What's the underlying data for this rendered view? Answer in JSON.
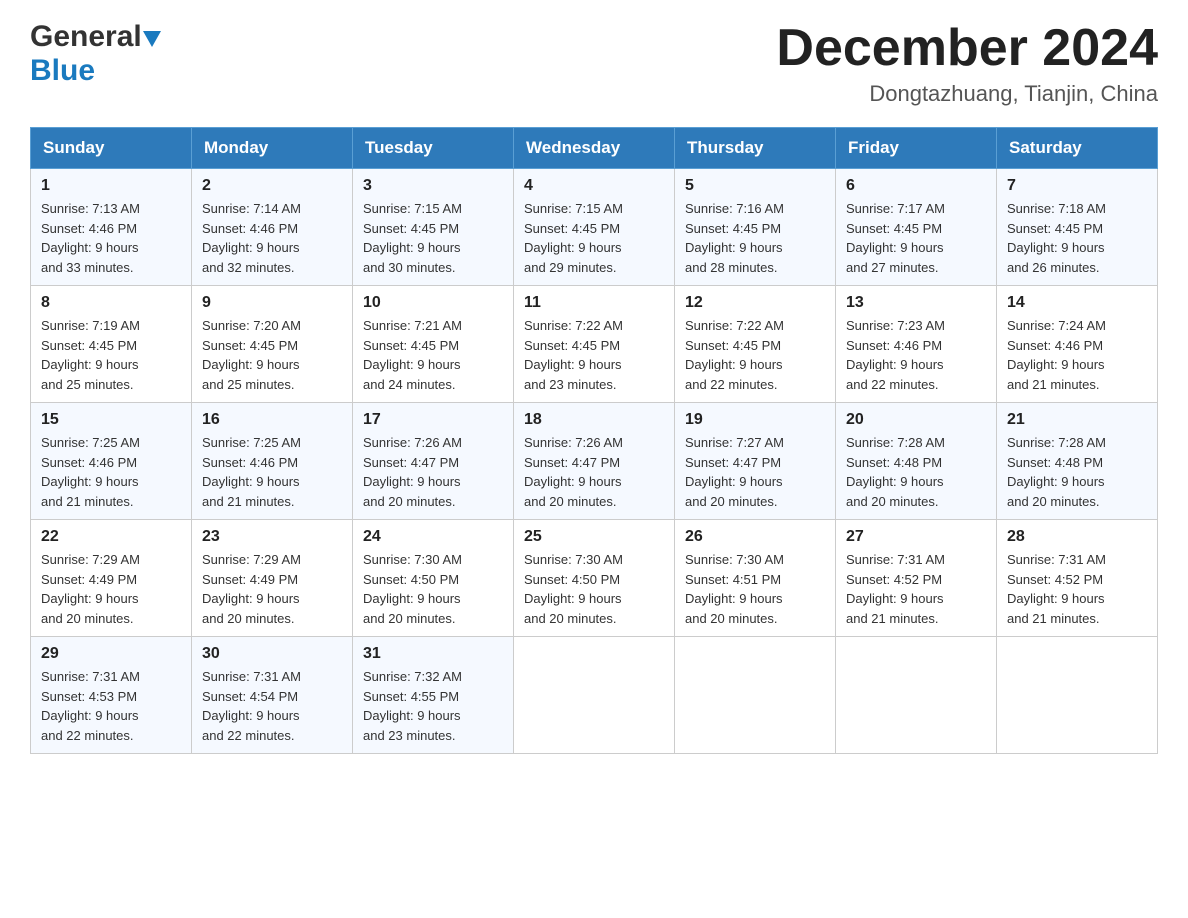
{
  "header": {
    "logo_general": "General",
    "logo_blue": "Blue",
    "main_title": "December 2024",
    "subtitle": "Dongtazhuang, Tianjin, China"
  },
  "days_of_week": [
    "Sunday",
    "Monday",
    "Tuesday",
    "Wednesday",
    "Thursday",
    "Friday",
    "Saturday"
  ],
  "weeks": [
    [
      {
        "day": "1",
        "sunrise": "7:13 AM",
        "sunset": "4:46 PM",
        "daylight": "9 hours and 33 minutes."
      },
      {
        "day": "2",
        "sunrise": "7:14 AM",
        "sunset": "4:46 PM",
        "daylight": "9 hours and 32 minutes."
      },
      {
        "day": "3",
        "sunrise": "7:15 AM",
        "sunset": "4:45 PM",
        "daylight": "9 hours and 30 minutes."
      },
      {
        "day": "4",
        "sunrise": "7:15 AM",
        "sunset": "4:45 PM",
        "daylight": "9 hours and 29 minutes."
      },
      {
        "day": "5",
        "sunrise": "7:16 AM",
        "sunset": "4:45 PM",
        "daylight": "9 hours and 28 minutes."
      },
      {
        "day": "6",
        "sunrise": "7:17 AM",
        "sunset": "4:45 PM",
        "daylight": "9 hours and 27 minutes."
      },
      {
        "day": "7",
        "sunrise": "7:18 AM",
        "sunset": "4:45 PM",
        "daylight": "9 hours and 26 minutes."
      }
    ],
    [
      {
        "day": "8",
        "sunrise": "7:19 AM",
        "sunset": "4:45 PM",
        "daylight": "9 hours and 25 minutes."
      },
      {
        "day": "9",
        "sunrise": "7:20 AM",
        "sunset": "4:45 PM",
        "daylight": "9 hours and 25 minutes."
      },
      {
        "day": "10",
        "sunrise": "7:21 AM",
        "sunset": "4:45 PM",
        "daylight": "9 hours and 24 minutes."
      },
      {
        "day": "11",
        "sunrise": "7:22 AM",
        "sunset": "4:45 PM",
        "daylight": "9 hours and 23 minutes."
      },
      {
        "day": "12",
        "sunrise": "7:22 AM",
        "sunset": "4:45 PM",
        "daylight": "9 hours and 22 minutes."
      },
      {
        "day": "13",
        "sunrise": "7:23 AM",
        "sunset": "4:46 PM",
        "daylight": "9 hours and 22 minutes."
      },
      {
        "day": "14",
        "sunrise": "7:24 AM",
        "sunset": "4:46 PM",
        "daylight": "9 hours and 21 minutes."
      }
    ],
    [
      {
        "day": "15",
        "sunrise": "7:25 AM",
        "sunset": "4:46 PM",
        "daylight": "9 hours and 21 minutes."
      },
      {
        "day": "16",
        "sunrise": "7:25 AM",
        "sunset": "4:46 PM",
        "daylight": "9 hours and 21 minutes."
      },
      {
        "day": "17",
        "sunrise": "7:26 AM",
        "sunset": "4:47 PM",
        "daylight": "9 hours and 20 minutes."
      },
      {
        "day": "18",
        "sunrise": "7:26 AM",
        "sunset": "4:47 PM",
        "daylight": "9 hours and 20 minutes."
      },
      {
        "day": "19",
        "sunrise": "7:27 AM",
        "sunset": "4:47 PM",
        "daylight": "9 hours and 20 minutes."
      },
      {
        "day": "20",
        "sunrise": "7:28 AM",
        "sunset": "4:48 PM",
        "daylight": "9 hours and 20 minutes."
      },
      {
        "day": "21",
        "sunrise": "7:28 AM",
        "sunset": "4:48 PM",
        "daylight": "9 hours and 20 minutes."
      }
    ],
    [
      {
        "day": "22",
        "sunrise": "7:29 AM",
        "sunset": "4:49 PM",
        "daylight": "9 hours and 20 minutes."
      },
      {
        "day": "23",
        "sunrise": "7:29 AM",
        "sunset": "4:49 PM",
        "daylight": "9 hours and 20 minutes."
      },
      {
        "day": "24",
        "sunrise": "7:30 AM",
        "sunset": "4:50 PM",
        "daylight": "9 hours and 20 minutes."
      },
      {
        "day": "25",
        "sunrise": "7:30 AM",
        "sunset": "4:50 PM",
        "daylight": "9 hours and 20 minutes."
      },
      {
        "day": "26",
        "sunrise": "7:30 AM",
        "sunset": "4:51 PM",
        "daylight": "9 hours and 20 minutes."
      },
      {
        "day": "27",
        "sunrise": "7:31 AM",
        "sunset": "4:52 PM",
        "daylight": "9 hours and 21 minutes."
      },
      {
        "day": "28",
        "sunrise": "7:31 AM",
        "sunset": "4:52 PM",
        "daylight": "9 hours and 21 minutes."
      }
    ],
    [
      {
        "day": "29",
        "sunrise": "7:31 AM",
        "sunset": "4:53 PM",
        "daylight": "9 hours and 22 minutes."
      },
      {
        "day": "30",
        "sunrise": "7:31 AM",
        "sunset": "4:54 PM",
        "daylight": "9 hours and 22 minutes."
      },
      {
        "day": "31",
        "sunrise": "7:32 AM",
        "sunset": "4:55 PM",
        "daylight": "9 hours and 23 minutes."
      },
      null,
      null,
      null,
      null
    ]
  ],
  "labels": {
    "sunrise": "Sunrise:",
    "sunset": "Sunset:",
    "daylight": "Daylight:"
  }
}
